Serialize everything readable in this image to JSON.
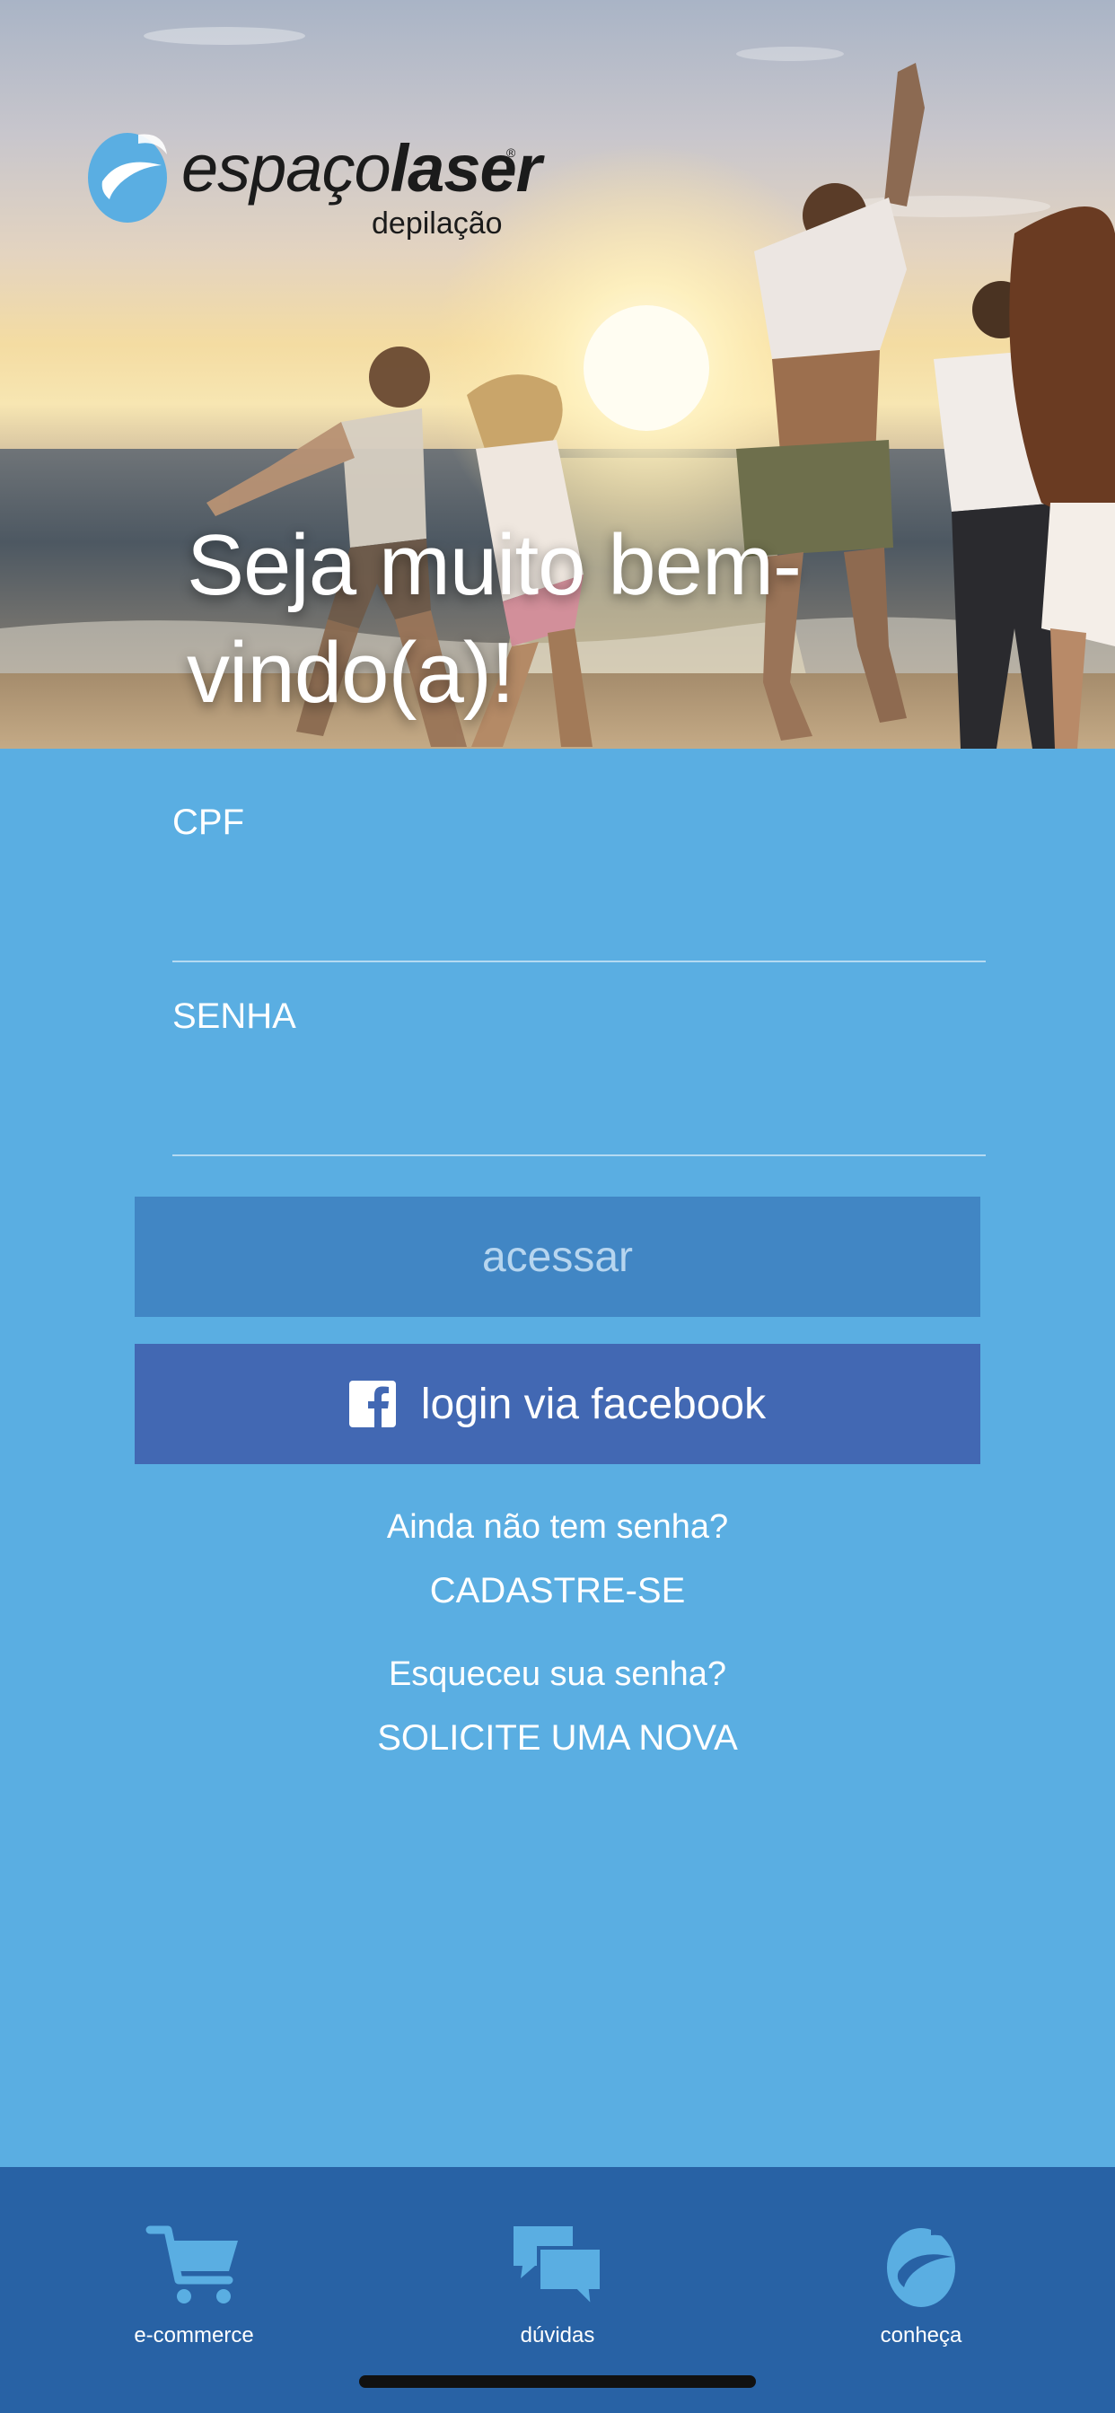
{
  "brand": {
    "name_light": "espaço",
    "name_bold": "laser",
    "registered": "®",
    "subtitle": "depilação",
    "color": "#5aaee2"
  },
  "hero": {
    "welcome": "Seja muito bem-vindo(a)!"
  },
  "form": {
    "cpf_label": "CPF",
    "cpf_value": "",
    "senha_label": "SENHA",
    "senha_value": ""
  },
  "buttons": {
    "access_label": "acessar",
    "facebook_label": "login via facebook",
    "facebook_icon": "facebook-icon"
  },
  "links": {
    "register_prompt": "Ainda não tem senha?",
    "register_action": "CADASTRE-SE",
    "forgot_prompt": "Esqueceu sua senha?",
    "forgot_action": "SOLICITE UMA NOVA"
  },
  "bottom_nav": {
    "items": [
      {
        "label": "e-commerce",
        "icon": "cart-icon"
      },
      {
        "label": "dúvidas",
        "icon": "chat-bubbles-icon"
      },
      {
        "label": "conheça",
        "icon": "brand-logo-icon"
      }
    ]
  },
  "colors": {
    "background": "#5aaee2",
    "access_button": "#4186c4",
    "facebook_button": "#4268b3",
    "bottom_nav": "#2862a5"
  }
}
